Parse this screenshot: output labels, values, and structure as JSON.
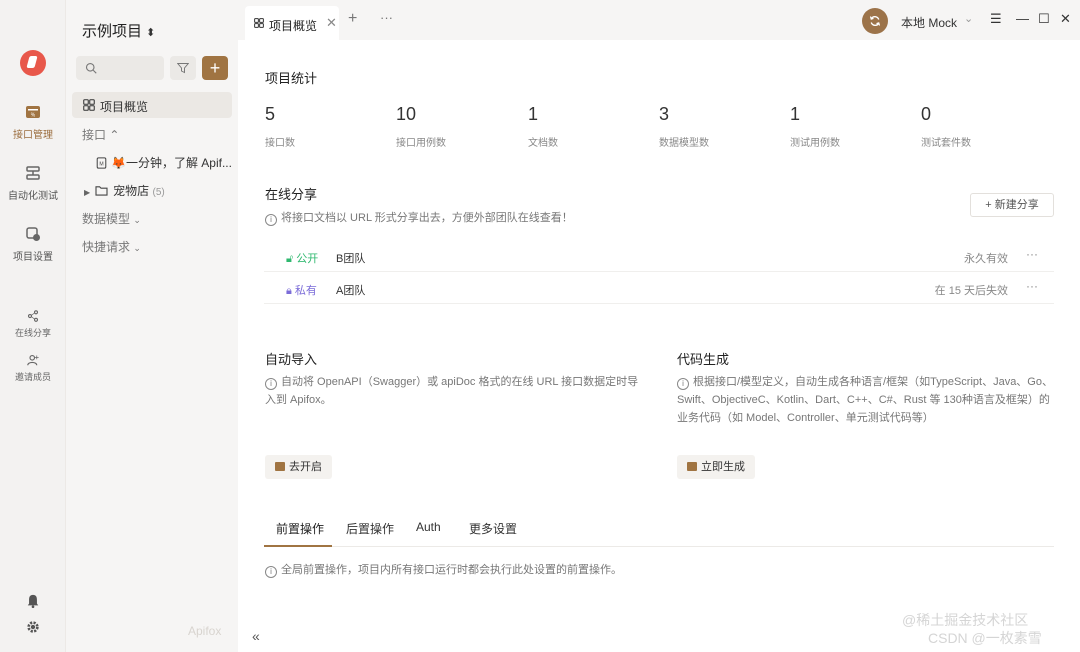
{
  "rail": {
    "items": [
      {
        "label": "接口管理",
        "icon": "api-management-icon"
      },
      {
        "label": "自动化测试",
        "icon": "automation-test-icon"
      },
      {
        "label": "项目设置",
        "icon": "project-settings-icon"
      },
      {
        "label": "在线分享",
        "icon": "share-icon"
      },
      {
        "label": "邀请成员",
        "icon": "invite-member-icon"
      }
    ]
  },
  "sidebar": {
    "project_title": "示例项目",
    "overview_label": "项目概览",
    "api_section": "接口",
    "api_item": "🦊一分钟，了解 Apif...",
    "folder_label": "宠物店",
    "folder_count": "(5)",
    "models_section": "数据模型",
    "quick_section": "快捷请求",
    "brand": "Apifox"
  },
  "topbar": {
    "tab_label": "项目概览",
    "mock_label": "本地 Mock"
  },
  "stats": {
    "title": "项目统计",
    "items": [
      {
        "value": "5",
        "label": "接口数"
      },
      {
        "value": "10",
        "label": "接口用例数"
      },
      {
        "value": "1",
        "label": "文档数"
      },
      {
        "value": "3",
        "label": "数据模型数"
      },
      {
        "value": "1",
        "label": "测试用例数"
      },
      {
        "value": "0",
        "label": "测试套件数"
      }
    ]
  },
  "share": {
    "title": "在线分享",
    "hint": "将接口文档以 URL 形式分享出去，方便外部团队在线查看！",
    "new_button": "新建分享",
    "rows": [
      {
        "tag": "公开",
        "name": "B团队",
        "expiry": "永久有效"
      },
      {
        "tag": "私有",
        "name": "A团队",
        "expiry": "在 15 天后失效"
      }
    ]
  },
  "import": {
    "title": "自动导入",
    "hint": "自动将 OpenAPI（Swagger）或 apiDoc 格式的在线 URL 接口数据定时导入到 Apifox。",
    "button": "去开启"
  },
  "codegen": {
    "title": "代码生成",
    "hint": "根据接口/模型定义，自动生成各种语言/框架（如TypeScript、Java、Go、Swift、ObjectiveC、Kotlin、Dart、C++、C#、Rust 等 130种语言及框架）的业务代码（如 Model、Controller、单元测试代码等）",
    "button": "立即生成"
  },
  "bottom_tabs": {
    "tabs": [
      "前置操作",
      "后置操作",
      "Auth",
      "更多设置"
    ],
    "hint": "全局前置操作，项目内所有接口运行时都会执行此处设置的前置操作。"
  },
  "watermark": {
    "line1": "@稀土掘金技术社区",
    "line2": "CSDN @一枚素雪"
  },
  "colors": {
    "accent": "#a07442",
    "public": "#2fb86f",
    "private": "#7b6cd8"
  }
}
